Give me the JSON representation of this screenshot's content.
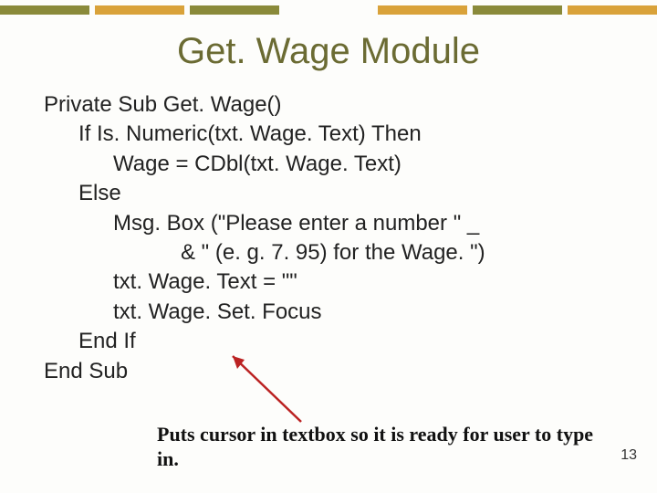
{
  "title": "Get. Wage Module",
  "code": {
    "l1": "Private Sub Get. Wage()",
    "l2": "If Is. Numeric(txt. Wage. Text) Then",
    "l3": "Wage = CDbl(txt. Wage. Text)",
    "l4": "Else",
    "l5": "Msg. Box (\"Please enter a number \" _",
    "l6": "& \" (e. g. 7. 95) for the Wage. \")",
    "l7": "txt. Wage. Text = \"\"",
    "l8": "txt. Wage. Set. Focus",
    "l9": "End If",
    "l10": "End Sub"
  },
  "annotation": "Puts cursor in textbox so it is ready for user to type in.",
  "page_number": "13"
}
